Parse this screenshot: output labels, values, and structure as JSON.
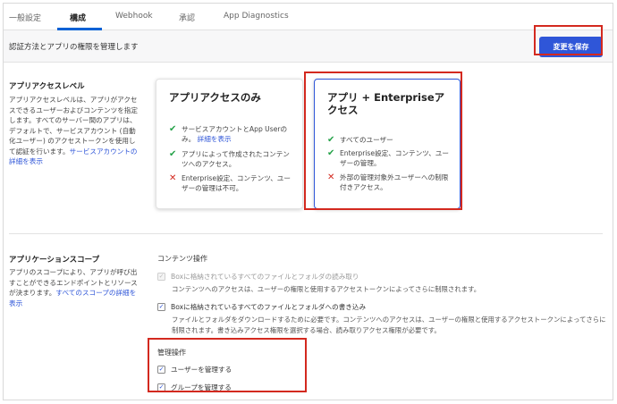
{
  "tabs": [
    {
      "label": "一般設定"
    },
    {
      "label": "構成"
    },
    {
      "label": "Webhook"
    },
    {
      "label": "承認"
    },
    {
      "label": "App Diagnostics"
    }
  ],
  "header": {
    "description": "認証方法とアプリの権限を管理します",
    "save_label": "変更を保存"
  },
  "access_level": {
    "title": "アプリアクセスレベル",
    "description": "アプリアクセスレベルは、アプリがアクセスできるユーザーおよびコンテンツを指定します。すべてのサーバー間のアプリは、デフォルトで、サービスアカウント (自動化ユーザー) のアクセストークンを使用して認証を行います。",
    "link": "サービスアカウントの詳細を表示",
    "cards": [
      {
        "title": "アプリアクセスのみ",
        "features": [
          {
            "icon": "check-icon",
            "text": "サービスアカウントとApp Userのみ。",
            "link": "詳細を表示"
          },
          {
            "icon": "check-icon",
            "text": "アプリによって作成されたコンテンツへのアクセス。"
          },
          {
            "icon": "cross-icon",
            "text": "Enterprise設定、コンテンツ、ユーザーの管理は不可。"
          }
        ]
      },
      {
        "title": "アプリ + Enterpriseアクセス",
        "features": [
          {
            "icon": "check-icon",
            "text": "すべてのユーザー"
          },
          {
            "icon": "check-icon",
            "text": "Enterprise設定、コンテンツ、ユーザーの管理。"
          },
          {
            "icon": "cross-icon",
            "text": "外部の管理対象外ユーザーへの制限付きアクセス。"
          }
        ]
      }
    ]
  },
  "scope": {
    "title": "アプリケーションスコープ",
    "description": "アプリのスコープにより、アプリが呼び出すことができるエンドポイントとリソースが決まります。",
    "link": "すべてのスコープの詳細を表示",
    "content_ops": {
      "title": "コンテンツ操作",
      "read": {
        "label": "Boxに格納されているすべてのファイルとフォルダの読み取り",
        "sub": "コンテンツへのアクセスは、ユーザーの権限と使用するアクセストークンによってさらに制限されます。"
      },
      "write": {
        "label": "Boxに格納されているすべてのファイルとフォルダへの書き込み",
        "sub": "ファイルとフォルダをダウンロードするために必要です。コンテンツへのアクセスは、ユーザーの権限と使用するアクセストークンによってさらに制限されます。書き込みアクセス権限を選択する場合、読み取りアクセス権限が必要です。"
      }
    },
    "admin_ops": {
      "title": "管理操作",
      "manage_users": "ユーザーを管理する",
      "manage_groups": "グループを管理する"
    }
  },
  "colors": {
    "accent": "#2f56d8",
    "highlight": "#d3291f",
    "check": "#26a34a",
    "cross": "#d3291f"
  }
}
